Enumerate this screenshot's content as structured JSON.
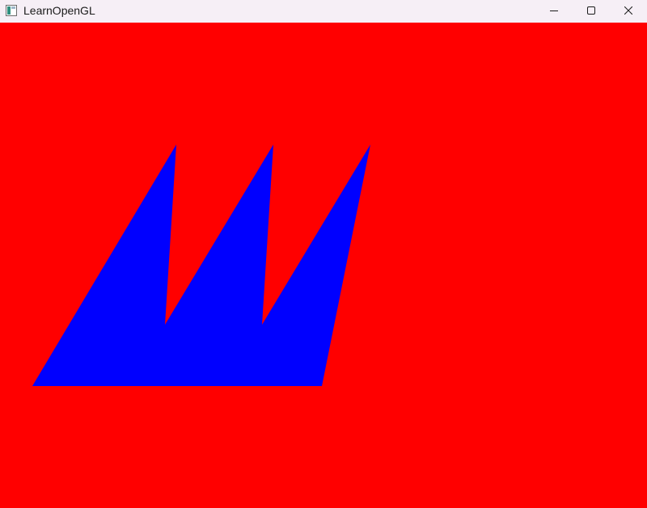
{
  "window": {
    "title": "LearnOpenGL",
    "app_icon": "opengl-window-icon",
    "controls": {
      "minimize_icon": "minimize-icon",
      "maximize_icon": "maximize-icon",
      "close_icon": "close-icon"
    }
  },
  "viewport": {
    "clear_color": "#ff0000",
    "shape_color": "#0000ff",
    "shape_description_icon": "rendered-triangles"
  }
}
